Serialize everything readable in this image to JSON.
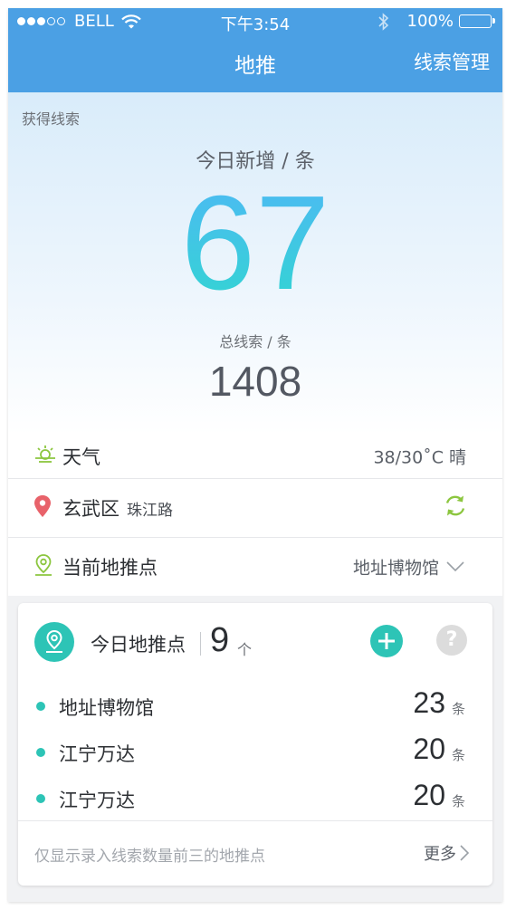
{
  "status_bar": {
    "carrier": "BELL",
    "time": "下午3:54",
    "battery": "100%"
  },
  "nav": {
    "title": "地推",
    "right_action": "线索管理"
  },
  "hero": {
    "section_label": "获得线索",
    "today_label": "今日新增 / 条",
    "today_count": "67",
    "total_label": "总线索 / 条",
    "total_count": "1408"
  },
  "info": {
    "weather_label": "天气",
    "weather_value": "38/30˚C 晴",
    "district": "玄武区",
    "street": "珠江路",
    "current_point_label": "当前地推点",
    "current_point_value": "地址博物馆"
  },
  "card": {
    "title": "今日地推点",
    "count": "9",
    "count_unit": "个",
    "items": [
      {
        "name": "地址博物馆",
        "value": "23",
        "unit": "条"
      },
      {
        "name": "江宁万达",
        "value": "20",
        "unit": "条"
      },
      {
        "name": "江宁万达",
        "value": "20",
        "unit": "条"
      }
    ],
    "footer_note": "仅显示录入线索数量前三的地推点",
    "more_label": "更多"
  },
  "colors": {
    "nav_blue": "#4ba0e4",
    "accent_teal": "#2dc4b6",
    "pin_red": "#e8626a",
    "icon_green": "#8cc63f"
  }
}
